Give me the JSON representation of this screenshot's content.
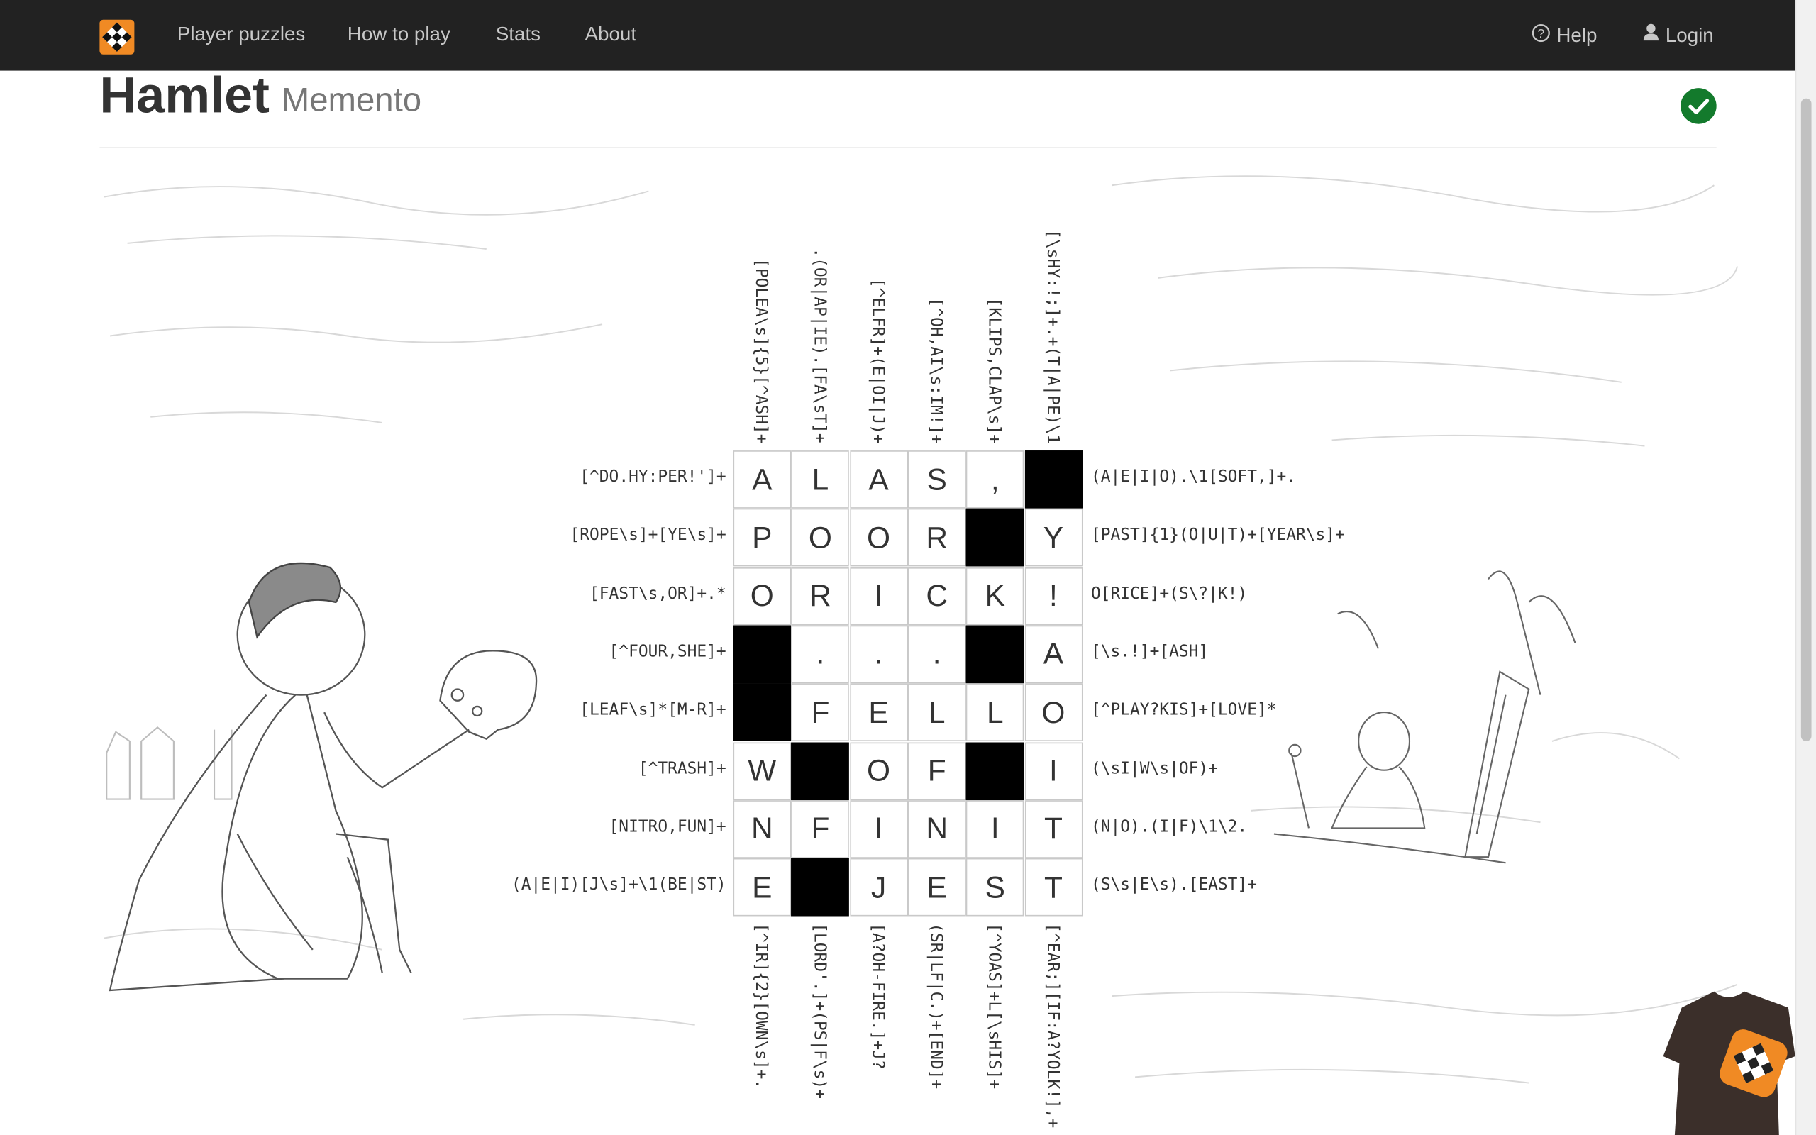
{
  "nav": {
    "links": [
      "Player puzzles",
      "How to play",
      "Stats",
      "About"
    ],
    "help": "Help",
    "login": "Login"
  },
  "puzzle": {
    "title": "Hamlet",
    "subtitle": "Memento",
    "status": "solved"
  },
  "clues": {
    "top": [
      "[POLEA\\s]{5}[^ASH]+",
      ".(OR|AP|IE).[FA\\sT]+",
      "[^ELFR]+(E|OI|J)+",
      "[^OH,AI\\s:IM!]+",
      "[KLIPS,CLAP\\s]+",
      "[\\sHY:!;]+.+(T|A|PE)\\1"
    ],
    "bottom": [
      "[^IR]{2}[OWN\\s]+.",
      "[LORD'.]+(PS|F\\s)+",
      "[A?OH-FIRE.]+J?",
      "(SR|LF|C.)+[END]+",
      "[^YOAS]+L[\\sHIS]+",
      "[^EAR;][IF:A?YOLK!],+"
    ],
    "left": [
      "[^DO.HY:PER!']+",
      "[ROPE\\s]+[YE\\s]+",
      "[FAST\\s,OR]+.*",
      "[^FOUR,SHE]+",
      "[LEAF\\s]*[M-R]+",
      "[^TRASH]+",
      "[NITRO,FUN]+",
      "(A|E|I)[J\\s]+\\1(BE|ST)"
    ],
    "right": [
      "(A|E|I|O).\\1[SOFT,]+.",
      "[PAST]{1}(O|U|T)+[YEAR\\s]+",
      "O[RICE]+(S\\?|K!)",
      "[\\s.!]+[ASH]",
      "[^PLAY?KIS]+[LOVE]*",
      "(\\sI|W\\s|OF)+",
      "(N|O).(I|F)\\1\\2.",
      "(S\\s|E\\s).[EAST]+"
    ]
  },
  "grid": [
    [
      "A",
      "L",
      "A",
      "S",
      ",",
      "#"
    ],
    [
      "P",
      "O",
      "O",
      "R",
      "#",
      "Y"
    ],
    [
      "O",
      "R",
      "I",
      "C",
      "K",
      "!"
    ],
    [
      "#",
      ".",
      ".",
      ".",
      "#",
      "A"
    ],
    [
      "#",
      "F",
      "E",
      "L",
      "L",
      "O"
    ],
    [
      "W",
      "#",
      "O",
      "F",
      "#",
      "I"
    ],
    [
      "N",
      "F",
      "I",
      "N",
      "I",
      "T"
    ],
    [
      "E",
      "#",
      "J",
      "E",
      "S",
      "T"
    ]
  ],
  "icons": {
    "logo": "puzzle-logo-icon",
    "help": "question-circle-icon",
    "login": "user-icon",
    "solved": "checkmark-icon"
  },
  "colors": {
    "navbar": "#222222",
    "brand": "#f08a24",
    "solved": "#137a2c"
  }
}
